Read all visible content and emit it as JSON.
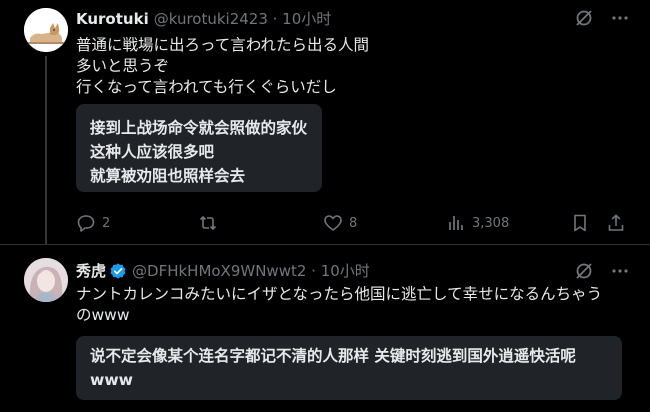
{
  "colors": {
    "background": "#000000",
    "text": "#e7e9ea",
    "muted": "#71767b",
    "verified": "#1d9bf0",
    "translation_bg": "#202327"
  },
  "posts": [
    {
      "name": "Kurotuki",
      "handle": "@kurotuki2423 · 10小时",
      "verified": false,
      "text": [
        "普通に戦場に出ろって言われたら出る人間",
        "多いと思うぞ",
        "行くなって言われても行くぐらいだし"
      ],
      "translation": [
        "接到上战场命令就会照做的家伙",
        "这种人应该很多吧",
        "就算被劝阻也照样会去"
      ],
      "stats": {
        "replies": "2",
        "reposts": "",
        "likes": "8",
        "views": "3,308"
      },
      "icons": [
        "grok-icon",
        "more-icon",
        "reply-icon",
        "repost-icon",
        "like-icon",
        "views-icon",
        "bookmark-icon",
        "share-icon"
      ]
    },
    {
      "name": "秀虎",
      "handle": "@DFHkHMoX9WNwwt2 · 10小时",
      "verified": true,
      "text": [
        "ナントカレンコみたいにイザとなったら他国に逃亡して幸せになるんちゃう",
        "のwww"
      ],
      "translation": [
        "说不定会像某个连名字都记不清的人那样 关键时刻逃到国外逍遥快活呢",
        "www"
      ],
      "icons": [
        "grok-icon",
        "more-icon"
      ]
    }
  ]
}
